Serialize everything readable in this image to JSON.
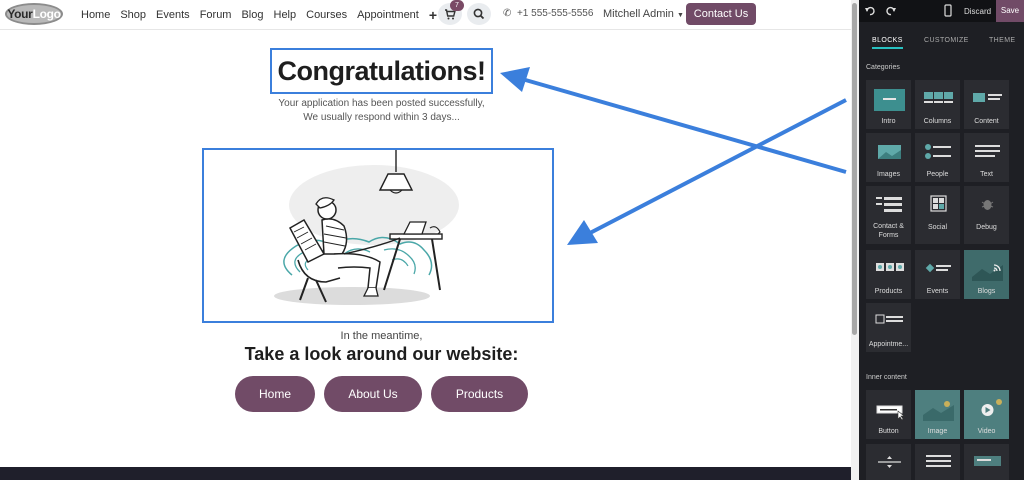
{
  "nav": {
    "logo_your": "Your",
    "logo_logo": "Logo",
    "links": [
      "Home",
      "Shop",
      "Events",
      "Forum",
      "Blog",
      "Help",
      "Courses",
      "Appointment"
    ],
    "plus": "+",
    "cart_count": "7",
    "phone": "+1 555-555-5556",
    "user": "Mitchell Admin",
    "contact": "Contact Us"
  },
  "main": {
    "title": "Congratulations!",
    "subtitle_1": "Your application has been posted successfully,",
    "subtitle_2": "We usually respond within 3 days...",
    "meantime": "In the meantime,",
    "heading": "Take a look around our website:",
    "buttons": [
      "Home",
      "About Us",
      "Products"
    ]
  },
  "panel": {
    "discard": "Discard",
    "save": "Save",
    "tabs": [
      "BLOCKS",
      "CUSTOMIZE",
      "THEME"
    ],
    "categories_label": "Categories",
    "categories": [
      "Intro",
      "Columns",
      "Content",
      "Images",
      "People",
      "Text",
      "Contact & Forms",
      "Social",
      "Debug",
      "Products",
      "Events",
      "Blogs",
      "Appointme..."
    ],
    "inner_label": "Inner content",
    "inner": [
      "Button",
      "Image",
      "Video"
    ]
  },
  "colors": {
    "brand": "#714b67",
    "selection": "#3b7fdc",
    "panel_bg": "#1e1f24",
    "tab_accent": "#28c0c0"
  }
}
